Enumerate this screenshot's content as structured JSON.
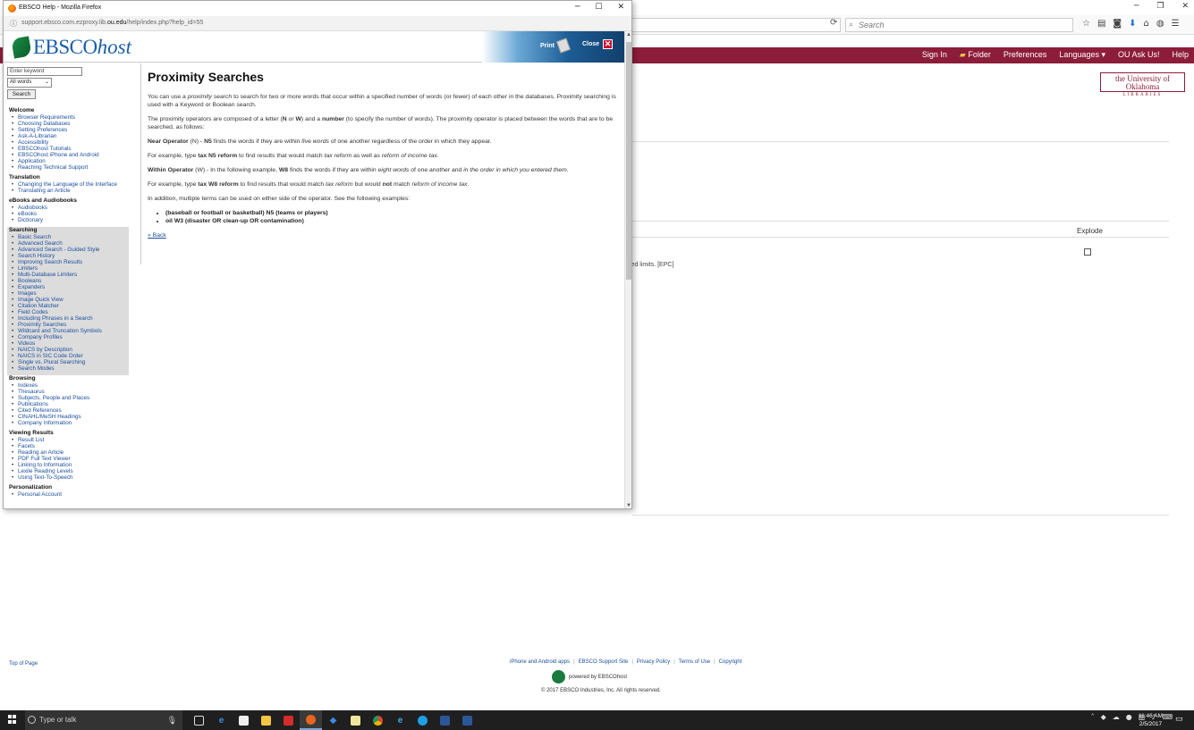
{
  "bg": {
    "search_placeholder": "Search",
    "topbar_links": [
      "Sign In",
      "Folder",
      "Preferences",
      "Languages ▾",
      "OU Ask Us!",
      "Help"
    ],
    "ou_logo_main": "the University of Oklahoma",
    "ou_logo_sub": "LIBRARIES",
    "explode_label": "Explode",
    "limits_text": "ied limits. [EPC]",
    "top_of_page": "Top of Page",
    "footer_links": [
      "iPhone and Android apps",
      "EBSCO Support Site",
      "Privacy Policy",
      "Terms of Use",
      "Copyright"
    ],
    "powered_by": "powered by EBSCOhost",
    "copyright": "© 2017 EBSCO Industries, Inc. All rights reserved."
  },
  "popup": {
    "title": "EBSCO Help - Mozilla Firefox",
    "url_prefix": "support.ebsco.com.ezproxy.lib.",
    "url_domain": "ou.edu",
    "url_suffix": "/help/index.php?help_id=55"
  },
  "header": {
    "logo_ebsco": "EBSCO",
    "logo_host": "host",
    "print_label": "Print",
    "close_label": "Close"
  },
  "sidebar": {
    "keyword_placeholder": "Enter keyword",
    "select_value": "All words",
    "search_button": "Search",
    "sections": [
      {
        "title": "Welcome",
        "items": [
          "Browser Requirements",
          "Choosing Databases",
          "Setting Preferences",
          "Ask-A-Librarian",
          "Accessibility",
          "EBSCOhost Tutorials",
          "EBSCOhost iPhone and Android",
          "Application",
          "Reaching Technical Support"
        ]
      },
      {
        "title": "Translation",
        "items": [
          "Changing the Language of the Interface",
          "Translating an Article"
        ]
      },
      {
        "title": "eBooks and Audiobooks",
        "items": [
          "Audiobooks",
          "eBooks",
          "Dictionary"
        ]
      },
      {
        "title": "Searching",
        "items": [
          "Basic Search",
          "Advanced Search",
          "Advanced Search - Guided Style",
          "Search History",
          "Improving Search Results",
          "Limiters",
          "Multi-Database Limiters",
          "Booleans",
          "Expanders",
          "Images",
          "Image Quick View",
          "Citation Matcher",
          "Field Codes",
          "Including Phrases in a Search",
          "Proximity Searches",
          "Wildcard and Truncation Symbols",
          "Company Profiles",
          "Videos",
          "NAICS by Description",
          "NAICS in SIC Code Order",
          "Single vs. Plural Searching",
          "Search Modes"
        ]
      },
      {
        "title": "Browsing",
        "items": [
          "Indexes",
          "Thesaurus",
          "Subjects, People and Places",
          "Publications",
          "Cited References",
          "CINAHL/MeSH Headings",
          "Company Information"
        ]
      },
      {
        "title": "Viewing Results",
        "items": [
          "Result List",
          "Facets",
          "Reading an Article",
          "PDF Full Text Viewer",
          "Linking to Information",
          "Lexile Reading Levels",
          "Using Text-To-Speech"
        ]
      },
      {
        "title": "Personalization",
        "items": [
          "Personal Account"
        ]
      }
    ]
  },
  "content": {
    "title": "Proximity Searches",
    "p1_a": "You can use a ",
    "p1_em": "proximity search",
    "p1_b": " to search for two or more words that occur within a specified number of words (or fewer) of each other in the databases. Proximity searching is used with a Keyword or Boolean search.",
    "p2_a": "The proximity operators are composed of a letter (",
    "p2_n": "N",
    "p2_or": " or ",
    "p2_w": "W",
    "p2_b": ") and a ",
    "p2_num": "number",
    "p2_c": " (to specify the number of words). The proximity operator is placed between the words that are to be searched, as follows:",
    "near_label": "Near Operator",
    "near_paren": " (N) - ",
    "near_n5": "N5",
    "near_a": " finds the words if they are within ",
    "near_em": "five words",
    "near_b": " of one another regardless of the order in which they appear.",
    "ex1_a": "For example, type ",
    "ex1_code": "tax N5 reform",
    "ex1_b": " to find results that would match ",
    "ex1_em1": "tax reform",
    "ex1_c": " as well as ",
    "ex1_em2": "reform of income tax",
    "ex1_d": ".",
    "within_label": "Within Operator",
    "within_paren": " (W) - In the following example, ",
    "within_w8": "W8",
    "within_a": " finds the words if they are within ",
    "within_em1": "eight words",
    "within_b": " of one another and ",
    "within_em2": "in the order in which you entered them.",
    "ex2_a": "For example, type ",
    "ex2_code": "tax W8 reform",
    "ex2_b": " to find results that would match ",
    "ex2_em1": "tax reform",
    "ex2_c": " but would ",
    "ex2_not": "not",
    "ex2_d": " match ",
    "ex2_em2": "reform of income tax",
    "ex2_e": ".",
    "p_multi": "In addition, multiple terms can be used on either side of the operator. See the following examples:",
    "examples": [
      "(baseball or football or basketball) N5 (teams or players)",
      "oil W3 (disaster OR clean-up OR contamination)"
    ],
    "back_link": "« Back"
  },
  "taskbar": {
    "search_placeholder": "Type or talk",
    "time": "11:46 AM",
    "date": "2/5/2017",
    "notif_count": "25"
  }
}
